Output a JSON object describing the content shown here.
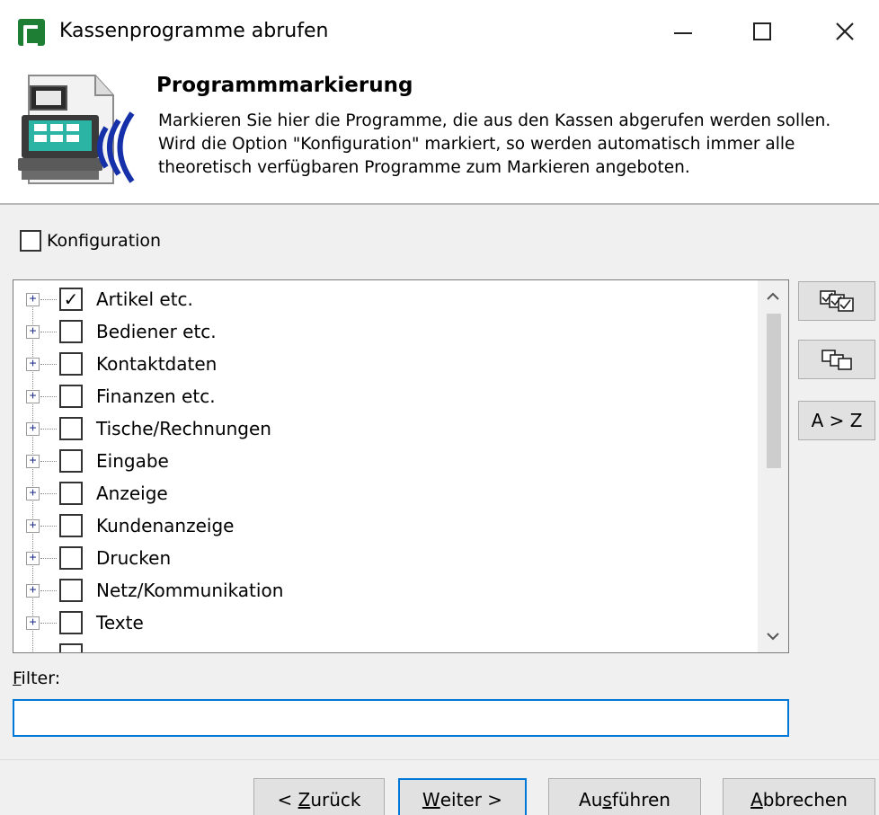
{
  "window": {
    "title": "Kassenprogramme abrufen",
    "icon": "app-logo-icon",
    "controls": [
      "minimize-icon",
      "maximize-icon",
      "close-icon"
    ]
  },
  "header": {
    "title": "Programmmarkierung",
    "description_lines": [
      "Markieren Sie hier die Programme, die aus den Kassen abgerufen werden sollen.",
      "Wird die Option \"Konfiguration\" markiert, so werden automatisch immer alle",
      "theoretisch verfügbaren Programme zum Markieren angeboten."
    ]
  },
  "konfiguration": {
    "label": "Konfiguration",
    "checked": false
  },
  "tree": {
    "items": [
      {
        "label": "Artikel etc.",
        "checked": true
      },
      {
        "label": "Bediener etc.",
        "checked": false
      },
      {
        "label": "Kontaktdaten",
        "checked": false
      },
      {
        "label": "Finanzen etc.",
        "checked": false
      },
      {
        "label": "Tische/Rechnungen",
        "checked": false
      },
      {
        "label": "Eingabe",
        "checked": false
      },
      {
        "label": "Anzeige",
        "checked": false
      },
      {
        "label": "Kundenanzeige",
        "checked": false
      },
      {
        "label": "Drucken",
        "checked": false
      },
      {
        "label": "Netz/Kommunikation",
        "checked": false
      },
      {
        "label": "Texte",
        "checked": false
      }
    ]
  },
  "side_buttons": {
    "sort_label": "A > Z"
  },
  "filter": {
    "label_accel": "F",
    "label_rest": "ilter:",
    "value": ""
  },
  "footer": {
    "back": {
      "prefix": "< ",
      "accel": "Z",
      "rest": "urück"
    },
    "next": {
      "accel": "W",
      "rest": "eiter >"
    },
    "run": {
      "pre": "Au",
      "accel": "s",
      "rest": "führen"
    },
    "cancel": {
      "accel": "A",
      "rest": "bbrechen"
    }
  },
  "colors": {
    "accent": "#0078d7",
    "brand": "#1e7e34",
    "dialog_bg": "#f0f0f0"
  }
}
